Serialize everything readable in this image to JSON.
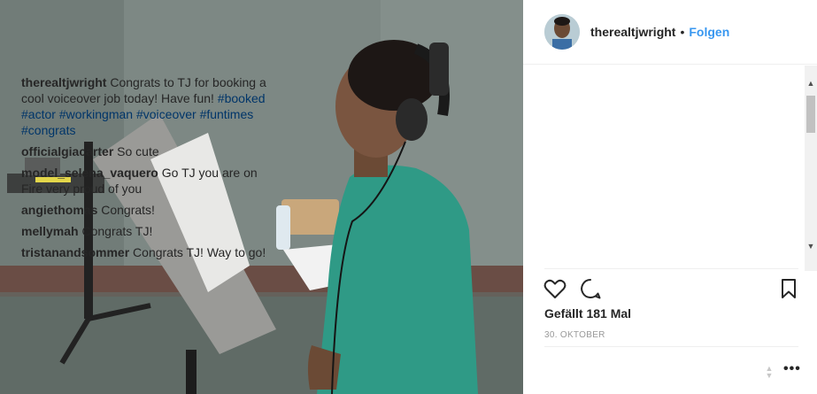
{
  "post": {
    "photo_alt": "Boy wearing headphones in a recording studio"
  },
  "header": {
    "username": "therealtjwright",
    "separator": "•",
    "follow_label": "Folgen"
  },
  "comments": [
    {
      "user": "therealtjwright",
      "text": "Congrats to TJ for booking a cool voiceover job today! Have fun!",
      "hashtags": [
        "#booked",
        "#actor",
        "#workingman",
        "#voiceover",
        "#funtimes",
        "#congrats"
      ]
    },
    {
      "user": "officialgiacarter",
      "text": "So cute"
    },
    {
      "user": "model_selena_vaquero",
      "text": "Go TJ you are on Fire very proud of you"
    },
    {
      "user": "angiethomas",
      "text": "Congrats!"
    },
    {
      "user": "mellymah",
      "text": "Congrats TJ!"
    },
    {
      "user": "tristanandsommer",
      "text": "Congrats TJ! Way to go!"
    }
  ],
  "actions": {
    "like_icon": "heart-icon",
    "comment_icon": "comment-bubble-icon",
    "save_icon": "bookmark-icon"
  },
  "likes_label": "Gefällt 181 Mal",
  "date_label": "30. OKTOBER",
  "more_label": "•••",
  "colors": {
    "link": "#003569",
    "follow": "#3897f0",
    "text": "#262626",
    "muted": "#999999",
    "sweater": "#2f9a86"
  }
}
